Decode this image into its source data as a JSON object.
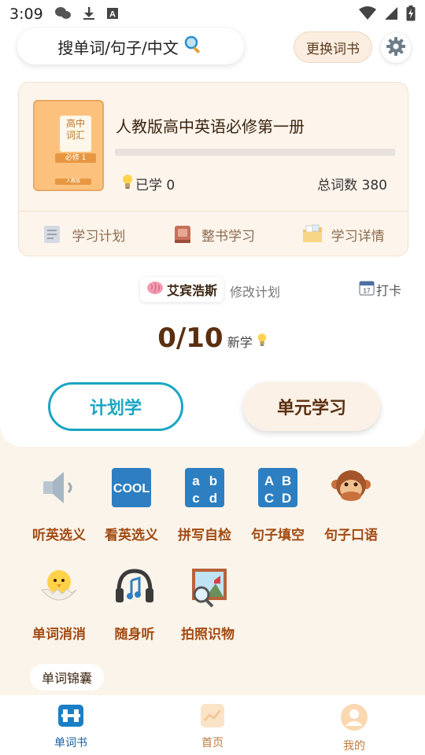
{
  "status_bar": {
    "time": "3:09",
    "icons": [
      "wechat-icon",
      "download-icon",
      "a-icon",
      "wifi-icon",
      "signal-icon",
      "battery-charging-icon"
    ]
  },
  "header": {
    "search_label": "搜单词/句子/中文",
    "change_book_label": "更换词书"
  },
  "book": {
    "cover_text": "高中\n词汇",
    "cover_band": "必修 1",
    "cover_foot": "人教版",
    "title": "人教版高中英语必修第一册",
    "progress_fraction": 0,
    "learned_label": "已学 0",
    "total_label": "总词数 380",
    "actions": [
      {
        "label": "学习计划",
        "icon": "plan-doc-icon",
        "color": "#c9ced6"
      },
      {
        "label": "整书学习",
        "icon": "book-icon",
        "color": "#c8705a"
      },
      {
        "label": "学习详情",
        "icon": "folder-icon",
        "color": "#f3c46b"
      }
    ]
  },
  "plan": {
    "method_label": "艾宾浩斯",
    "modify_label": "修改计划",
    "checkin_label": "打卡"
  },
  "counter": {
    "value": "0/10",
    "unit": "新学"
  },
  "buttons": {
    "plan_study": "计划学",
    "unit_study": "单元学习"
  },
  "tiles": [
    {
      "label": "听英选义",
      "icon": "speaker-icon"
    },
    {
      "label": "看英选义",
      "icon": "cool-icon",
      "icon_text": "COOL"
    },
    {
      "label": "拼写自检",
      "icon": "abcd-lower-icon",
      "icon_text": "abcd"
    },
    {
      "label": "句子填空",
      "icon": "abcd-upper-icon",
      "icon_text": "ABCD"
    },
    {
      "label": "句子口语",
      "icon": "speak-no-evil-monkey-icon"
    },
    {
      "label": "单词消消",
      "icon": "hatching-chick-icon"
    },
    {
      "label": "随身听",
      "icon": "headphones-music-icon"
    },
    {
      "label": "拍照识物",
      "icon": "photo-magnifier-icon"
    }
  ],
  "pocket_label": "单词锦囊",
  "nav": [
    {
      "label": "单词书",
      "icon": "wordbook-icon",
      "active": true
    },
    {
      "label": "首页",
      "icon": "home-chart-icon",
      "active": false
    },
    {
      "label": "我的",
      "icon": "profile-icon",
      "active": false
    }
  ],
  "colors": {
    "accent_cyan": "#1aa6c2",
    "brown_text": "#a24a12",
    "progress": "#f6a42e",
    "background": "#fbf4ea"
  }
}
